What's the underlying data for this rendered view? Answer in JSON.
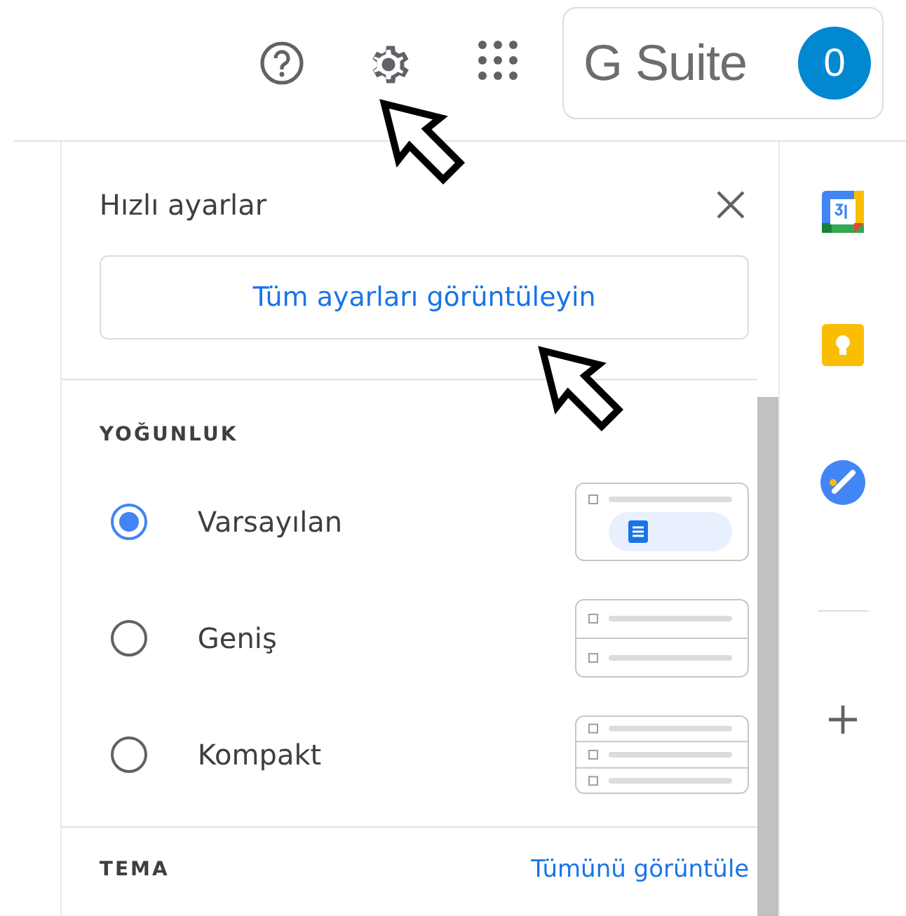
{
  "top_bar": {
    "brand": "G Suite",
    "avatar_letter": "0"
  },
  "quick_settings": {
    "title": "Hızlı ayarlar",
    "all_settings_button": "Tüm ayarları görüntüleyin",
    "density": {
      "heading": "YOĞUNLUK",
      "options": [
        {
          "label": "Varsayılan",
          "selected": true,
          "kind": "default"
        },
        {
          "label": "Geniş",
          "selected": false,
          "kind": "comfortable"
        },
        {
          "label": "Kompakt",
          "selected": false,
          "kind": "compact"
        }
      ]
    },
    "theme": {
      "heading": "TEMA",
      "link": "Tümünü görüntüle"
    }
  }
}
